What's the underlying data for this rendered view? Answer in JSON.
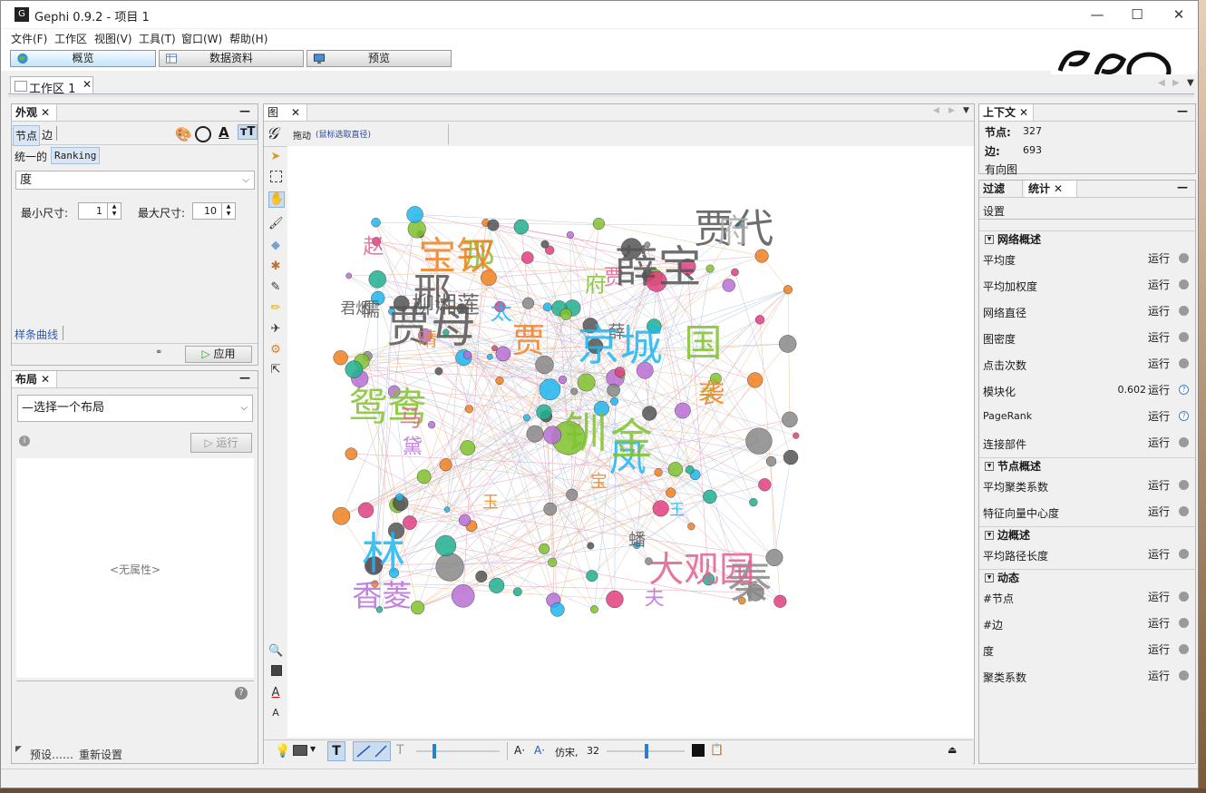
{
  "window": {
    "title": "Gephi 0.9.2 - 项目 1",
    "minimize": "—",
    "maximize": "☐",
    "close": "✕"
  },
  "menu": [
    "文件(F)",
    "工作区",
    "视图(V)",
    "工具(T)",
    "窗口(W)",
    "帮助(H)"
  ],
  "toolbar": {
    "overview": "概览",
    "data": "数据资料",
    "preview": "预览"
  },
  "workspace_tab": "工作区 1",
  "appearance": {
    "title": "外观",
    "tab_nodes": "节点",
    "tab_edges": "边",
    "mode_unique": "统一的",
    "mode_ranking": "Ranking",
    "attribute": "度",
    "min_size_label": "最小尺寸:",
    "min_size": "1",
    "max_size_label": "最大尺寸:",
    "max_size": "10",
    "spline": "样条曲线",
    "apply": "应用"
  },
  "layout": {
    "title": "布局",
    "select": "—选择一个布局",
    "run": "运行",
    "no_props": "<无属性>",
    "presets": "预设……",
    "reset": "重新设置"
  },
  "graph": {
    "tab": "图",
    "drag_label": "拖动",
    "drag_hint": "(鼠标选取直径)",
    "font_name": "仿宋,",
    "font_size": "32",
    "word_cloud": [
      {
        "t": "王",
        "c": "#1fb6f0"
      },
      {
        "t": "贾",
        "c": "#e06090"
      },
      {
        "t": "贾母",
        "c": "#555"
      },
      {
        "t": "凤",
        "c": "#1fb6f0"
      },
      {
        "t": "金",
        "c": "#7fc22e"
      },
      {
        "t": "钏",
        "c": "#7fc22e"
      },
      {
        "t": "夫",
        "c": "#b86fd6"
      },
      {
        "t": "薛",
        "c": "#555"
      },
      {
        "t": "蟠",
        "c": "#555"
      },
      {
        "t": "那",
        "c": "#7fc22e"
      },
      {
        "t": "荣",
        "c": "#7fc22e"
      },
      {
        "t": "国",
        "c": "#7fc22e"
      },
      {
        "t": "府",
        "c": "#7fc22e"
      },
      {
        "t": "京城",
        "c": "#1fb6f0"
      },
      {
        "t": "晴",
        "c": "#f08020"
      },
      {
        "t": "袭",
        "c": "#f08020"
      },
      {
        "t": "君烟",
        "c": "#555"
      },
      {
        "t": "香菱",
        "c": "#b86fd6"
      },
      {
        "t": "太",
        "c": "#1fb6f0"
      },
      {
        "t": "贾",
        "c": "#f08020"
      },
      {
        "t": "宝",
        "c": "#f08020"
      },
      {
        "t": "玉",
        "c": "#f08020"
      },
      {
        "t": "林",
        "c": "#1fb6f0"
      },
      {
        "t": "黛",
        "c": "#b86fd6"
      },
      {
        "t": "儒",
        "c": "#555"
      },
      {
        "t": "柳湘莲",
        "c": "#555"
      },
      {
        "t": "秦",
        "c": "#888"
      },
      {
        "t": "大观园",
        "c": "#e06090"
      },
      {
        "t": "鸳鸯",
        "c": "#7fc22e"
      },
      {
        "t": "宝钗",
        "c": "#f08020"
      },
      {
        "t": "薛宝",
        "c": "#555"
      },
      {
        "t": "贾代",
        "c": "#555"
      },
      {
        "t": "邢",
        "c": "#555"
      },
      {
        "t": "赵",
        "c": "#e06090"
      },
      {
        "t": "府",
        "c": "#aaa"
      },
      {
        "t": "马",
        "c": "#e06090"
      }
    ]
  },
  "context": {
    "title": "上下文",
    "nodes_label": "节点:",
    "nodes": "327",
    "edges_label": "边:",
    "edges": "693",
    "type": "有向图"
  },
  "stats": {
    "tab_filter": "过滤",
    "tab_stats": "统计",
    "settings": "设置",
    "run": "运行",
    "sections": [
      {
        "title": "网络概述",
        "rows": [
          {
            "label": "平均度",
            "value": "",
            "hint": "dot"
          },
          {
            "label": "平均加权度",
            "value": "",
            "hint": "dot"
          },
          {
            "label": "网络直径",
            "value": "",
            "hint": "dot"
          },
          {
            "label": "图密度",
            "value": "",
            "hint": "dot"
          },
          {
            "label": "点击次数",
            "value": "",
            "hint": "dot"
          },
          {
            "label": "模块化",
            "value": "0.602",
            "hint": "q"
          },
          {
            "label": "PageRank",
            "value": "",
            "hint": "q"
          },
          {
            "label": "连接部件",
            "value": "",
            "hint": "dot"
          }
        ]
      },
      {
        "title": "节点概述",
        "rows": [
          {
            "label": "平均聚类系数",
            "value": "",
            "hint": "dot"
          },
          {
            "label": "特征向量中心度",
            "value": "",
            "hint": "dot"
          }
        ]
      },
      {
        "title": "边概述",
        "rows": [
          {
            "label": "平均路径长度",
            "value": "",
            "hint": "dot"
          }
        ]
      },
      {
        "title": "动态",
        "rows": [
          {
            "label": "#节点",
            "value": "",
            "hint": "dot"
          },
          {
            "label": "#边",
            "value": "",
            "hint": "dot"
          },
          {
            "label": "度",
            "value": "",
            "hint": "dot"
          },
          {
            "label": "聚类系数",
            "value": "",
            "hint": "dot"
          }
        ]
      }
    ]
  }
}
